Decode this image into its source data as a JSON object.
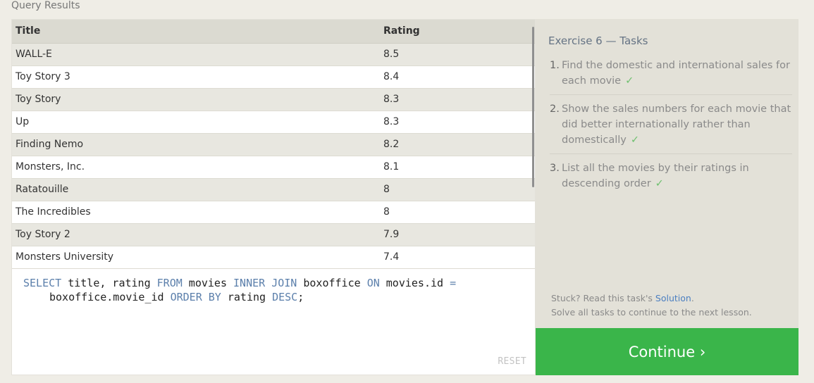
{
  "results_label": "Query Results",
  "table": {
    "columns": [
      "Title",
      "Rating"
    ],
    "rows": [
      [
        "WALL-E",
        "8.5"
      ],
      [
        "Toy Story 3",
        "8.4"
      ],
      [
        "Toy Story",
        "8.3"
      ],
      [
        "Up",
        "8.3"
      ],
      [
        "Finding Nemo",
        "8.2"
      ],
      [
        "Monsters, Inc.",
        "8.1"
      ],
      [
        "Ratatouille",
        "8"
      ],
      [
        "The Incredibles",
        "8"
      ],
      [
        "Toy Story 2",
        "7.9"
      ],
      [
        "Monsters University",
        "7.4"
      ]
    ]
  },
  "editor": {
    "code_tokens": [
      [
        {
          "t": "SELECT",
          "kw": true
        },
        {
          "t": " title, rating ",
          "kw": false
        },
        {
          "t": "FROM",
          "kw": true
        },
        {
          "t": " movies ",
          "kw": false
        },
        {
          "t": "INNER JOIN",
          "kw": true
        },
        {
          "t": " boxoffice ",
          "kw": false
        },
        {
          "t": "ON",
          "kw": true
        },
        {
          "t": " movies.id ",
          "kw": false
        },
        {
          "t": "=",
          "kw": true
        }
      ],
      [
        {
          "t": "boxoffice.movie_id ",
          "kw": false
        },
        {
          "t": "ORDER BY",
          "kw": true
        },
        {
          "t": " rating ",
          "kw": false
        },
        {
          "t": "DESC",
          "kw": true
        },
        {
          "t": ";",
          "kw": false
        }
      ]
    ],
    "reset_label": "RESET"
  },
  "exercise": {
    "title": "Exercise 6 — Tasks",
    "tasks": [
      {
        "num": "1.",
        "text": "Find the domestic and international sales for each movie",
        "done": true
      },
      {
        "num": "2.",
        "text": "Show the sales numbers for each movie that did better internationally rather than domestically",
        "done": true
      },
      {
        "num": "3.",
        "text": "List all the movies by their ratings in descending order",
        "done": true
      }
    ],
    "check_glyph": "✓",
    "stuck_prefix": "Stuck? Read this task's ",
    "solution_link": "Solution",
    "stuck_suffix": ".",
    "solve_all_text": "Solve all tasks to continue to the next lesson."
  },
  "continue_label": "Continue ›",
  "colors": {
    "accent_green": "#3ab54a",
    "keyword_blue": "#5b7fab",
    "link_blue": "#4b7fc1"
  }
}
